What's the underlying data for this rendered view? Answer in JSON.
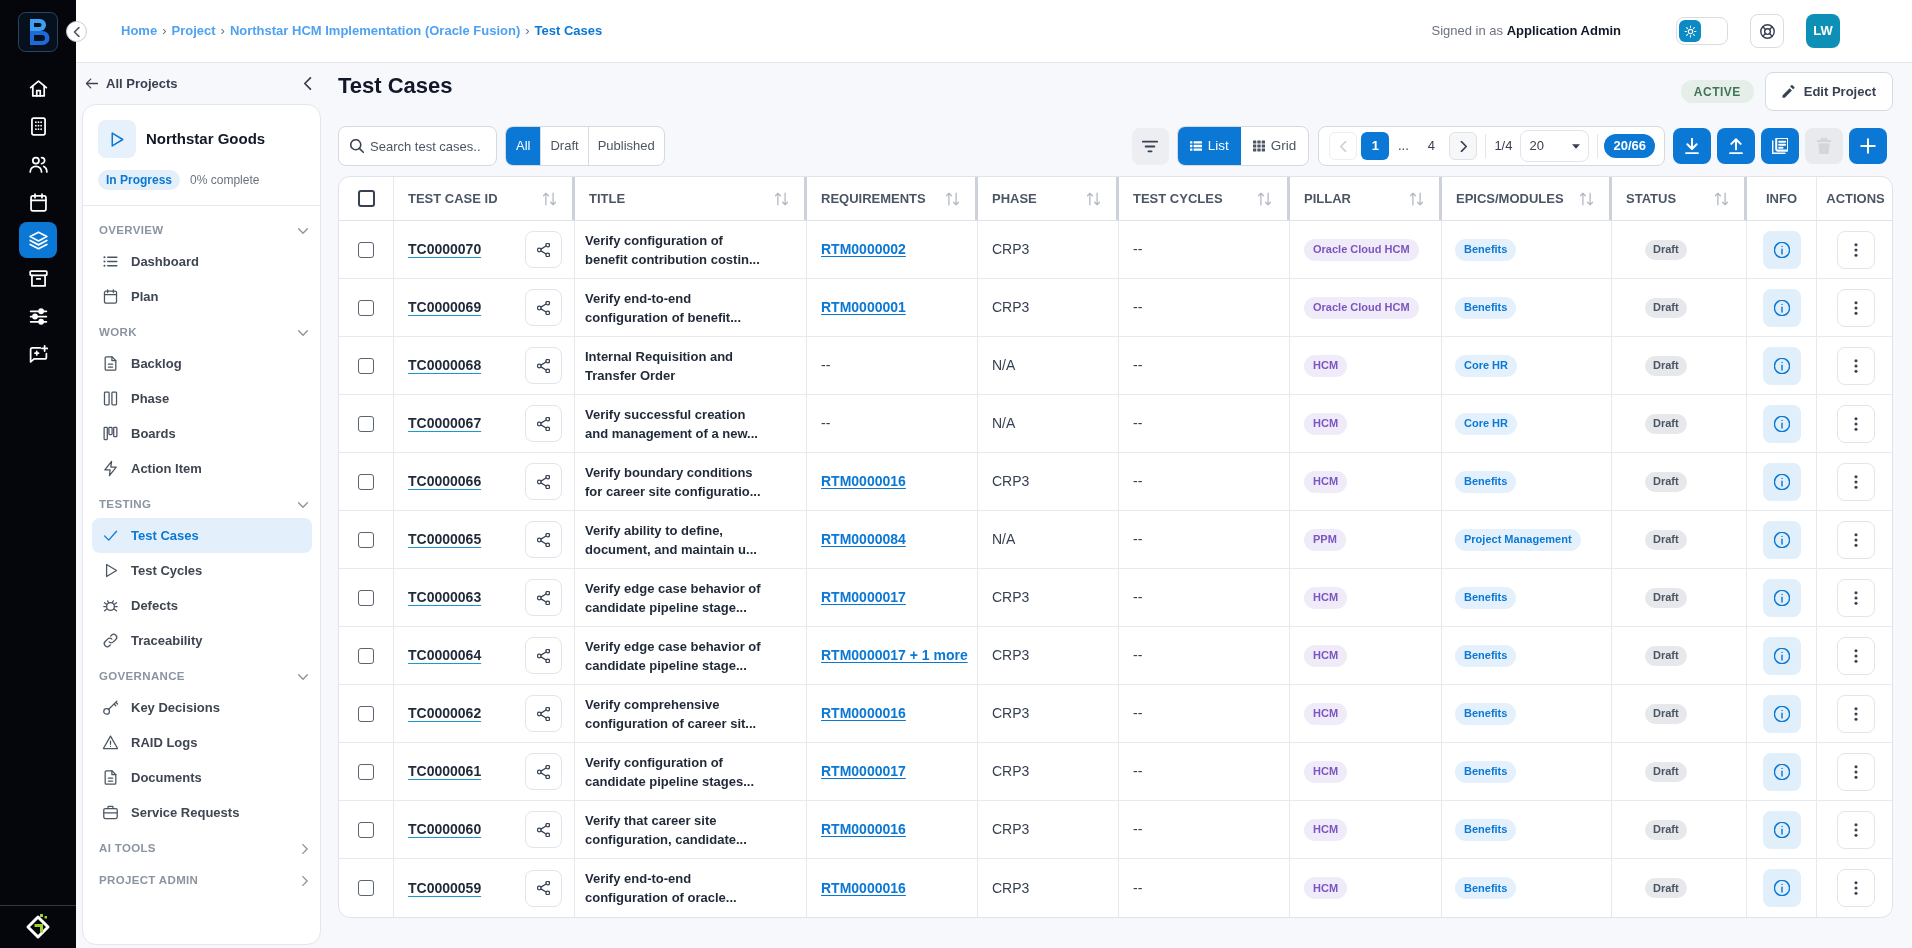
{
  "app_rail": {
    "items": [
      {
        "selected": false
      },
      {
        "selected": false
      },
      {
        "selected": false
      },
      {
        "selected": false
      },
      {
        "selected": true
      },
      {
        "selected": false
      },
      {
        "selected": false
      },
      {
        "selected": false
      }
    ]
  },
  "top_bar": {
    "breadcrumb": [
      {
        "label": "Home",
        "current": false
      },
      {
        "label": "Project",
        "current": false
      },
      {
        "label": "Northstar HCM Implementation (Oracle Fusion)",
        "current": false
      },
      {
        "label": "Test Cases",
        "current": true
      }
    ],
    "separator": "›",
    "signed_in": "Signed in as **Application Admin**",
    "theme_toggle": {
      "dark_mode": false
    },
    "avatar": "LW"
  },
  "sidebar": {
    "back_link": "All Projects",
    "project": {
      "name": "Northstar Goods",
      "status": "In Progress",
      "progress": "0% complete"
    },
    "sections": [
      {
        "title": "OVERVIEW",
        "expanded": true,
        "items": [
          {
            "label": "Dashboard",
            "selected": false
          },
          {
            "label": "Plan",
            "selected": false
          }
        ]
      },
      {
        "title": "WORK",
        "expanded": true,
        "items": [
          {
            "label": "Backlog",
            "selected": false
          },
          {
            "label": "Phase",
            "selected": false
          },
          {
            "label": "Boards",
            "selected": false
          },
          {
            "label": "Action Item",
            "selected": false
          }
        ]
      },
      {
        "title": "TESTING",
        "expanded": true,
        "items": [
          {
            "label": "Test Cases",
            "selected": true
          },
          {
            "label": "Test Cycles",
            "selected": false
          },
          {
            "label": "Defects",
            "selected": false
          },
          {
            "label": "Traceability",
            "selected": false
          }
        ]
      },
      {
        "title": "GOVERNANCE",
        "expanded": true,
        "items": [
          {
            "label": "Key Decisions",
            "selected": false
          },
          {
            "label": "RAID Logs",
            "selected": false
          },
          {
            "label": "Documents",
            "selected": false
          },
          {
            "label": "Service Requests",
            "selected": false
          }
        ]
      },
      {
        "title": "AI TOOLS",
        "expanded": false
      },
      {
        "title": "PROJECT ADMIN",
        "expanded": false
      }
    ]
  },
  "page_header": {
    "title": "Test Cases",
    "project_status": "ACTIVE",
    "edit_button": "Edit Project"
  },
  "toolbar": {
    "search": {
      "placeholder": "Search test cases.."
    },
    "status_filter": [
      {
        "label": "All",
        "selected": true
      },
      {
        "label": "Draft",
        "selected": false
      },
      {
        "label": "Published",
        "selected": false
      }
    ],
    "view_toggle": [
      {
        "label": "List",
        "selected": true
      },
      {
        "label": "Grid",
        "selected": false
      }
    ],
    "pagination": {
      "prev": {
        "disabled": true
      },
      "pages": [
        {
          "kind": "page",
          "label": "1",
          "selected": true
        },
        {
          "kind": "gap",
          "label": "..."
        },
        {
          "kind": "page",
          "label": "4",
          "selected": false
        }
      ],
      "next": {
        "disabled": false
      },
      "page_indicator": "1/4",
      "page_size": "20",
      "count": "20/66"
    },
    "actions": [
      {
        "disabled": false
      },
      {
        "disabled": false
      },
      {
        "disabled": false
      },
      {
        "disabled": true
      },
      {
        "disabled": false
      }
    ]
  },
  "table": {
    "select_all": {
      "checked": false
    },
    "columns": [
      {
        "label": "TEST CASE ID",
        "sortable": true
      },
      {
        "label": "TITLE",
        "sortable": true
      },
      {
        "label": "REQUIREMENTS",
        "sortable": true
      },
      {
        "label": "PHASE",
        "sortable": true
      },
      {
        "label": "TEST CYCLES",
        "sortable": true
      },
      {
        "label": "PILLAR",
        "sortable": true
      },
      {
        "label": "EPICS/MODULES",
        "sortable": true
      },
      {
        "label": "STATUS",
        "sortable": true
      },
      {
        "label": "INFO",
        "sortable": false
      },
      {
        "label": "ACTIONS",
        "sortable": false
      }
    ],
    "rows": [
      {
        "checked": false,
        "id": "TC0000070",
        "title": "Verify configuration of benefit contribution costin...",
        "requirements": {
          "text": "RTM0000002",
          "link": true
        },
        "phase": "CRP3",
        "test_cycles": "--",
        "pillar": "Oracle Cloud HCM",
        "epic": "Benefits",
        "status": "Draft"
      },
      {
        "checked": false,
        "id": "TC0000069",
        "title": "Verify end-to-end configuration of benefit...",
        "requirements": {
          "text": "RTM0000001",
          "link": true
        },
        "phase": "CRP3",
        "test_cycles": "--",
        "pillar": "Oracle Cloud HCM",
        "epic": "Benefits",
        "status": "Draft"
      },
      {
        "checked": false,
        "id": "TC0000068",
        "title": "Internal Requisition and Transfer Order",
        "requirements": {
          "text": "--",
          "link": false
        },
        "phase": "N/A",
        "test_cycles": "--",
        "pillar": "HCM",
        "epic": "Core HR",
        "status": "Draft"
      },
      {
        "checked": false,
        "id": "TC0000067",
        "title": "Verify successful creation and management of a new...",
        "requirements": {
          "text": "--",
          "link": false
        },
        "phase": "N/A",
        "test_cycles": "--",
        "pillar": "HCM",
        "epic": "Core HR",
        "status": "Draft"
      },
      {
        "checked": false,
        "id": "TC0000066",
        "title": "Verify boundary conditions for career site configuratio...",
        "requirements": {
          "text": "RTM0000016",
          "link": true
        },
        "phase": "CRP3",
        "test_cycles": "--",
        "pillar": "HCM",
        "epic": "Benefits",
        "status": "Draft"
      },
      {
        "checked": false,
        "id": "TC0000065",
        "title": "Verify ability to define, document, and maintain u...",
        "requirements": {
          "text": "RTM0000084",
          "link": true
        },
        "phase": "N/A",
        "test_cycles": "--",
        "pillar": "PPM",
        "epic": "Project Management",
        "status": "Draft"
      },
      {
        "checked": false,
        "id": "TC0000063",
        "title": "Verify edge case behavior of candidate pipeline stage...",
        "requirements": {
          "text": "RTM0000017",
          "link": true
        },
        "phase": "CRP3",
        "test_cycles": "--",
        "pillar": "HCM",
        "epic": "Benefits",
        "status": "Draft"
      },
      {
        "checked": false,
        "id": "TC0000064",
        "title": "Verify edge case behavior of candidate pipeline stage...",
        "requirements": {
          "text": "RTM0000017 + 1 more",
          "link": true
        },
        "phase": "CRP3",
        "test_cycles": "--",
        "pillar": "HCM",
        "epic": "Benefits",
        "status": "Draft"
      },
      {
        "checked": false,
        "id": "TC0000062",
        "title": "Verify comprehensive configuration of career sit...",
        "requirements": {
          "text": "RTM0000016",
          "link": true
        },
        "phase": "CRP3",
        "test_cycles": "--",
        "pillar": "HCM",
        "epic": "Benefits",
        "status": "Draft"
      },
      {
        "checked": false,
        "id": "TC0000061",
        "title": "Verify configuration of candidate pipeline stages...",
        "requirements": {
          "text": "RTM0000017",
          "link": true
        },
        "phase": "CRP3",
        "test_cycles": "--",
        "pillar": "HCM",
        "epic": "Benefits",
        "status": "Draft"
      },
      {
        "checked": false,
        "id": "TC0000060",
        "title": "Verify that career site configuration, candidate...",
        "requirements": {
          "text": "RTM0000016",
          "link": true
        },
        "phase": "CRP3",
        "test_cycles": "--",
        "pillar": "HCM",
        "epic": "Benefits",
        "status": "Draft"
      },
      {
        "checked": false,
        "id": "TC0000059",
        "title": "Verify end-to-end configuration of oracle...",
        "requirements": {
          "text": "RTM0000016",
          "link": true
        },
        "phase": "CRP3",
        "test_cycles": "--",
        "pillar": "HCM",
        "epic": "Benefits",
        "status": "Draft"
      }
    ]
  }
}
